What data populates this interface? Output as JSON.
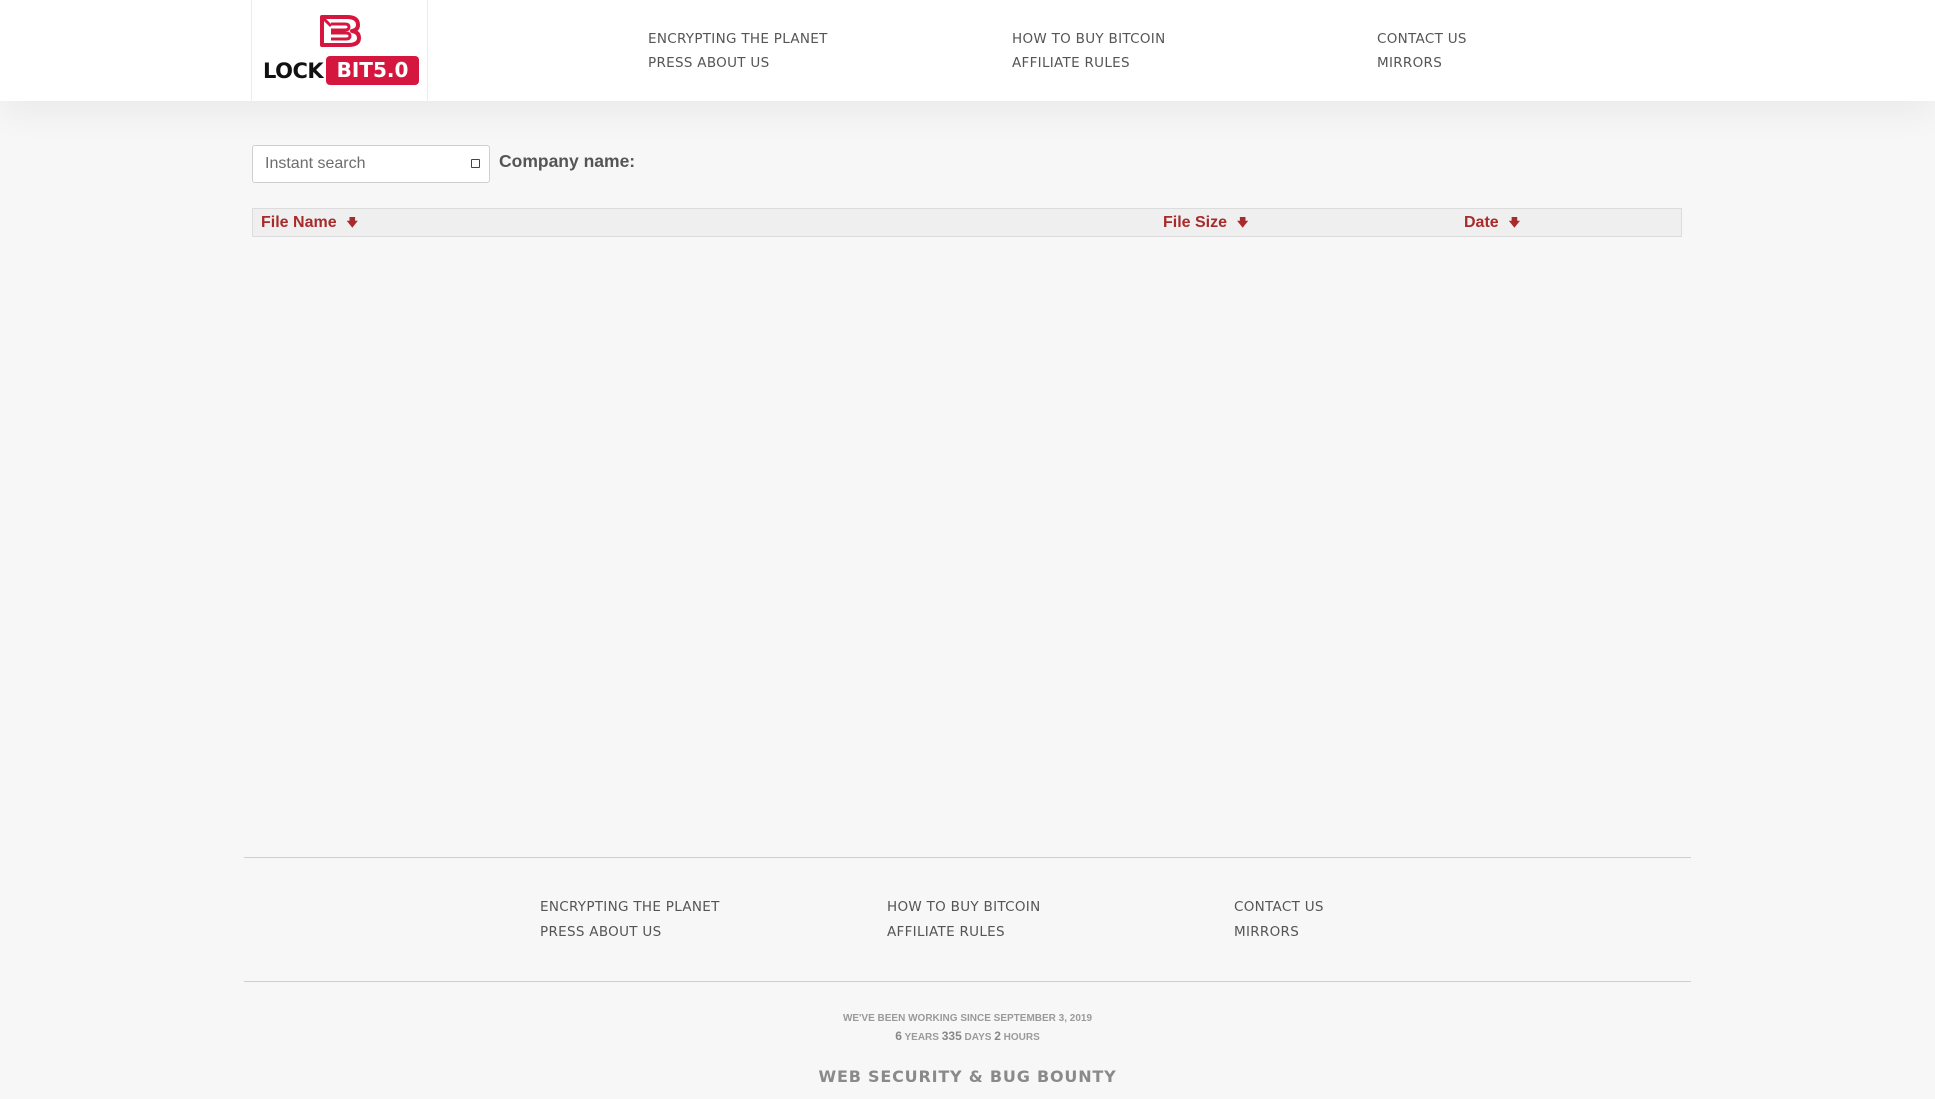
{
  "logo": {
    "lock_text": "LOCK",
    "bit_text": "BIT5.0",
    "mark_icon": "lockbit-b-logo-icon",
    "brand_color": "#d5173f"
  },
  "nav": {
    "items": [
      {
        "label": "ENCRYPTING THE PLANET"
      },
      {
        "label": "PRESS ABOUT US"
      },
      {
        "label": "HOW TO BUY BITCOIN"
      },
      {
        "label": "AFFILIATE RULES"
      },
      {
        "label": "CONTACT US"
      },
      {
        "label": "MIRRORS"
      }
    ]
  },
  "search": {
    "placeholder": "Instant search",
    "value": "",
    "company_label": "Company name:"
  },
  "table": {
    "columns": [
      {
        "label": "File Name",
        "sort_icon": "sort-arrow-down-icon"
      },
      {
        "label": "File Size",
        "sort_icon": "sort-arrow-down-icon"
      },
      {
        "label": "Date",
        "sort_icon": "sort-arrow-down-icon"
      }
    ],
    "rows": [],
    "header_text_color": "#a82b2b"
  },
  "footer": {
    "items": [
      {
        "label": "ENCRYPTING THE PLANET"
      },
      {
        "label": "PRESS ABOUT US"
      },
      {
        "label": "HOW TO BUY BITCOIN"
      },
      {
        "label": "AFFILIATE RULES"
      },
      {
        "label": "CONTACT US"
      },
      {
        "label": "MIRRORS"
      }
    ],
    "since_text": "WE'VE BEEN WORKING SINCE SEPTEMBER 3, 2019",
    "uptime": {
      "years_value": "6",
      "years_label": "YEARS",
      "days_value": "335",
      "days_label": "DAYS",
      "hours_value": "2",
      "hours_label": "HOURS"
    },
    "bounty_text": "WEB SECURITY & BUG BOUNTY"
  }
}
